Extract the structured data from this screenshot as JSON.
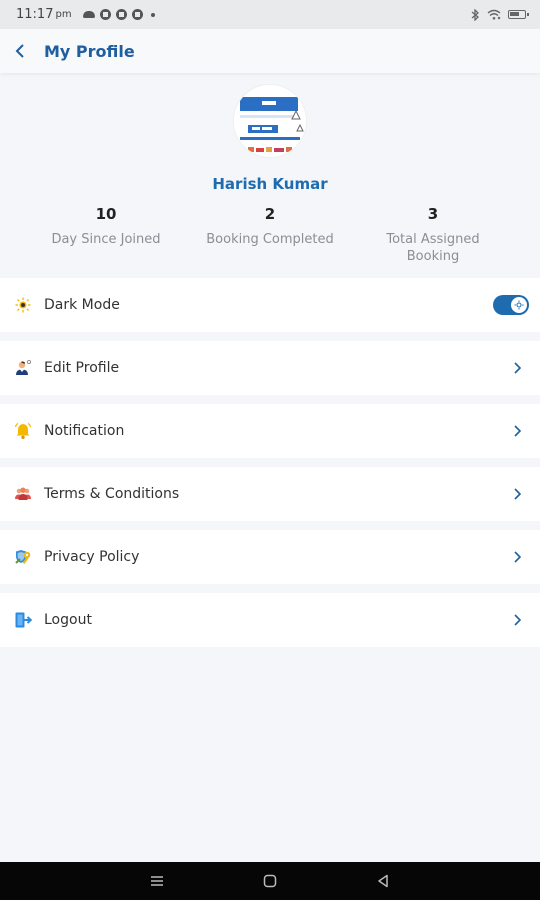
{
  "status_bar": {
    "time": "11:17",
    "ampm": "pm"
  },
  "header": {
    "title": "My Profile"
  },
  "profile": {
    "name": "Harish Kumar"
  },
  "stats": [
    {
      "value": "10",
      "label": "Day Since Joined"
    },
    {
      "value": "2",
      "label": "Booking Completed"
    },
    {
      "value": "3",
      "label": "Total Assigned Booking"
    }
  ],
  "menu": {
    "dark_mode": {
      "label": "Dark Mode",
      "enabled": true
    },
    "items": [
      {
        "label": "Edit Profile",
        "icon": "user-edit-icon"
      },
      {
        "label": "Notification",
        "icon": "bell-icon"
      },
      {
        "label": "Terms & Conditions",
        "icon": "people-icon"
      },
      {
        "label": "Privacy Policy",
        "icon": "shield-key-icon"
      },
      {
        "label": "Logout",
        "icon": "logout-icon"
      }
    ]
  },
  "colors": {
    "accent": "#1f6bb0",
    "title": "#1f5fa0",
    "background": "#f4f6f9"
  }
}
